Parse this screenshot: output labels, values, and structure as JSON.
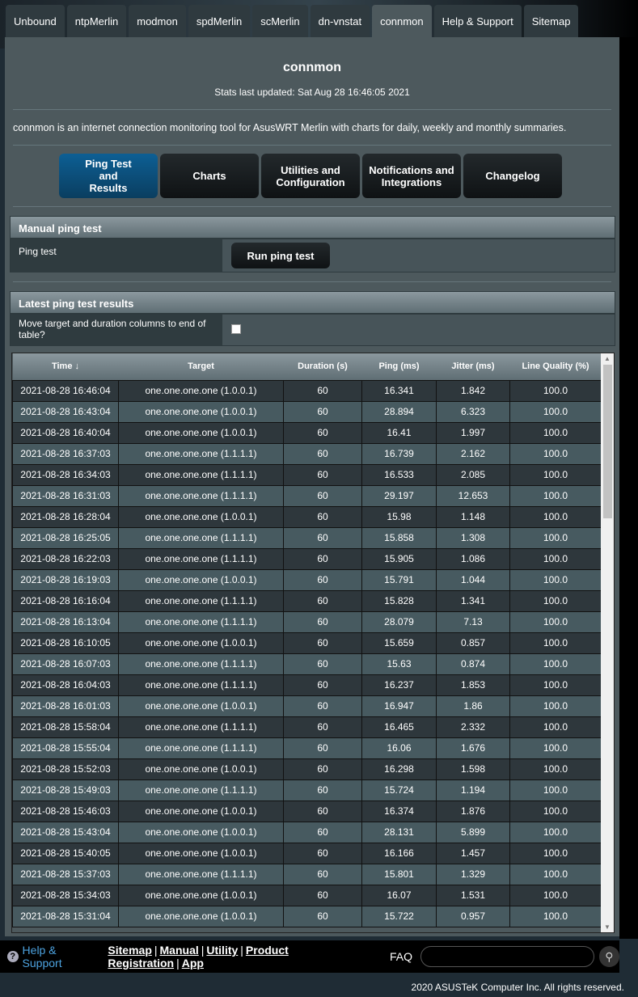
{
  "tabs": [
    "Unbound",
    "ntpMerlin",
    "modmon",
    "spdMerlin",
    "scMerlin",
    "dn-vnstat",
    "connmon",
    "Help & Support",
    "Sitemap"
  ],
  "active_tab": "connmon",
  "title": "connmon",
  "stats_updated": "Stats last updated: Sat Aug 28 16:46:05 2021",
  "description": "connmon is an internet connection monitoring tool for AsusWRT Merlin with charts for daily, weekly and monthly summaries.",
  "nav_buttons": [
    "Ping Test and Results",
    "Charts",
    "Utilities and Configuration",
    "Notifications and Integrations",
    "Changelog"
  ],
  "manual": {
    "header": "Manual ping test",
    "label": "Ping test",
    "button": "Run ping test"
  },
  "latest": {
    "header": "Latest ping test results",
    "move_label": "Move target and duration columns to end of table?",
    "move_checked": false
  },
  "columns": [
    "Time ↓",
    "Target",
    "Duration (s)",
    "Ping (ms)",
    "Jitter (ms)",
    "Line Quality (%)"
  ],
  "rows": [
    [
      "2021-08-28 16:46:04",
      "one.one.one.one (1.0.0.1)",
      "60",
      "16.341",
      "1.842",
      "100.0"
    ],
    [
      "2021-08-28 16:43:04",
      "one.one.one.one (1.0.0.1)",
      "60",
      "28.894",
      "6.323",
      "100.0"
    ],
    [
      "2021-08-28 16:40:04",
      "one.one.one.one (1.0.0.1)",
      "60",
      "16.41",
      "1.997",
      "100.0"
    ],
    [
      "2021-08-28 16:37:03",
      "one.one.one.one (1.1.1.1)",
      "60",
      "16.739",
      "2.162",
      "100.0"
    ],
    [
      "2021-08-28 16:34:03",
      "one.one.one.one (1.1.1.1)",
      "60",
      "16.533",
      "2.085",
      "100.0"
    ],
    [
      "2021-08-28 16:31:03",
      "one.one.one.one (1.1.1.1)",
      "60",
      "29.197",
      "12.653",
      "100.0"
    ],
    [
      "2021-08-28 16:28:04",
      "one.one.one.one (1.0.0.1)",
      "60",
      "15.98",
      "1.148",
      "100.0"
    ],
    [
      "2021-08-28 16:25:05",
      "one.one.one.one (1.1.1.1)",
      "60",
      "15.858",
      "1.308",
      "100.0"
    ],
    [
      "2021-08-28 16:22:03",
      "one.one.one.one (1.1.1.1)",
      "60",
      "15.905",
      "1.086",
      "100.0"
    ],
    [
      "2021-08-28 16:19:03",
      "one.one.one.one (1.0.0.1)",
      "60",
      "15.791",
      "1.044",
      "100.0"
    ],
    [
      "2021-08-28 16:16:04",
      "one.one.one.one (1.1.1.1)",
      "60",
      "15.828",
      "1.341",
      "100.0"
    ],
    [
      "2021-08-28 16:13:04",
      "one.one.one.one (1.1.1.1)",
      "60",
      "28.079",
      "7.13",
      "100.0"
    ],
    [
      "2021-08-28 16:10:05",
      "one.one.one.one (1.0.0.1)",
      "60",
      "15.659",
      "0.857",
      "100.0"
    ],
    [
      "2021-08-28 16:07:03",
      "one.one.one.one (1.1.1.1)",
      "60",
      "15.63",
      "0.874",
      "100.0"
    ],
    [
      "2021-08-28 16:04:03",
      "one.one.one.one (1.1.1.1)",
      "60",
      "16.237",
      "1.853",
      "100.0"
    ],
    [
      "2021-08-28 16:01:03",
      "one.one.one.one (1.0.0.1)",
      "60",
      "16.947",
      "1.86",
      "100.0"
    ],
    [
      "2021-08-28 15:58:04",
      "one.one.one.one (1.1.1.1)",
      "60",
      "16.465",
      "2.332",
      "100.0"
    ],
    [
      "2021-08-28 15:55:04",
      "one.one.one.one (1.1.1.1)",
      "60",
      "16.06",
      "1.676",
      "100.0"
    ],
    [
      "2021-08-28 15:52:03",
      "one.one.one.one (1.0.0.1)",
      "60",
      "16.298",
      "1.598",
      "100.0"
    ],
    [
      "2021-08-28 15:49:03",
      "one.one.one.one (1.1.1.1)",
      "60",
      "15.724",
      "1.194",
      "100.0"
    ],
    [
      "2021-08-28 15:46:03",
      "one.one.one.one (1.0.0.1)",
      "60",
      "16.374",
      "1.876",
      "100.0"
    ],
    [
      "2021-08-28 15:43:04",
      "one.one.one.one (1.0.0.1)",
      "60",
      "28.131",
      "5.899",
      "100.0"
    ],
    [
      "2021-08-28 15:40:05",
      "one.one.one.one (1.0.0.1)",
      "60",
      "16.166",
      "1.457",
      "100.0"
    ],
    [
      "2021-08-28 15:37:03",
      "one.one.one.one (1.1.1.1)",
      "60",
      "15.801",
      "1.329",
      "100.0"
    ],
    [
      "2021-08-28 15:34:03",
      "one.one.one.one (1.0.0.1)",
      "60",
      "16.07",
      "1.531",
      "100.0"
    ],
    [
      "2021-08-28 15:31:04",
      "one.one.one.one (1.0.0.1)",
      "60",
      "15.722",
      "0.957",
      "100.0"
    ]
  ],
  "footer": {
    "help": "Help & Support",
    "links": [
      "Sitemap",
      "Manual",
      "Utility",
      "Product Registration",
      "App"
    ],
    "faq": "FAQ",
    "copyright": "2020 ASUSTeK Computer Inc. All rights reserved."
  },
  "colors": {
    "panel": "#4d595d",
    "active_button": "#0d5f94",
    "help_link": "#4da3e0"
  }
}
